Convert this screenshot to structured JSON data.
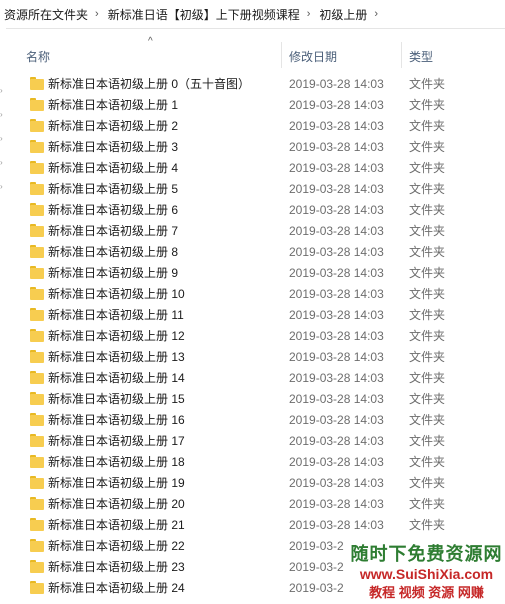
{
  "breadcrumb": {
    "items": [
      "资源所在文件夹",
      "新标准日语【初级】上下册视频课程",
      "初级上册"
    ],
    "separator": "›",
    "trailing_chevron": "›"
  },
  "columns": {
    "name": "名称",
    "date": "修改日期",
    "type": "类型"
  },
  "rows": [
    {
      "name": "新标准日本语初级上册 0（五十音图）",
      "date": "2019-03-28 14:03",
      "type": "文件夹"
    },
    {
      "name": "新标准日本语初级上册 1",
      "date": "2019-03-28 14:03",
      "type": "文件夹"
    },
    {
      "name": "新标准日本语初级上册 2",
      "date": "2019-03-28 14:03",
      "type": "文件夹"
    },
    {
      "name": "新标准日本语初级上册 3",
      "date": "2019-03-28 14:03",
      "type": "文件夹"
    },
    {
      "name": "新标准日本语初级上册 4",
      "date": "2019-03-28 14:03",
      "type": "文件夹"
    },
    {
      "name": "新标准日本语初级上册 5",
      "date": "2019-03-28 14:03",
      "type": "文件夹"
    },
    {
      "name": "新标准日本语初级上册 6",
      "date": "2019-03-28 14:03",
      "type": "文件夹"
    },
    {
      "name": "新标准日本语初级上册 7",
      "date": "2019-03-28 14:03",
      "type": "文件夹"
    },
    {
      "name": "新标准日本语初级上册 8",
      "date": "2019-03-28 14:03",
      "type": "文件夹"
    },
    {
      "name": "新标准日本语初级上册 9",
      "date": "2019-03-28 14:03",
      "type": "文件夹"
    },
    {
      "name": "新标准日本语初级上册 10",
      "date": "2019-03-28 14:03",
      "type": "文件夹"
    },
    {
      "name": "新标准日本语初级上册 11",
      "date": "2019-03-28 14:03",
      "type": "文件夹"
    },
    {
      "name": "新标准日本语初级上册 12",
      "date": "2019-03-28 14:03",
      "type": "文件夹"
    },
    {
      "name": "新标准日本语初级上册 13",
      "date": "2019-03-28 14:03",
      "type": "文件夹"
    },
    {
      "name": "新标准日本语初级上册 14",
      "date": "2019-03-28 14:03",
      "type": "文件夹"
    },
    {
      "name": "新标准日本语初级上册 15",
      "date": "2019-03-28 14:03",
      "type": "文件夹"
    },
    {
      "name": "新标准日本语初级上册 16",
      "date": "2019-03-28 14:03",
      "type": "文件夹"
    },
    {
      "name": "新标准日本语初级上册 17",
      "date": "2019-03-28 14:03",
      "type": "文件夹"
    },
    {
      "name": "新标准日本语初级上册 18",
      "date": "2019-03-28 14:03",
      "type": "文件夹"
    },
    {
      "name": "新标准日本语初级上册 19",
      "date": "2019-03-28 14:03",
      "type": "文件夹"
    },
    {
      "name": "新标准日本语初级上册 20",
      "date": "2019-03-28 14:03",
      "type": "文件夹"
    },
    {
      "name": "新标准日本语初级上册 21",
      "date": "2019-03-28 14:03",
      "type": "文件夹"
    },
    {
      "name": "新标准日本语初级上册 22",
      "date": "2019-03-2",
      "type": ""
    },
    {
      "name": "新标准日本语初级上册 23",
      "date": "2019-03-2",
      "type": ""
    },
    {
      "name": "新标准日本语初级上册 24",
      "date": "2019-03-2",
      "type": ""
    }
  ],
  "watermark": {
    "line1": "随时下免费资源网",
    "line2": "www.SuiShiXia.com",
    "line3": "教程 视频 资源 网赚"
  },
  "icons": {
    "folder": "folder-icon",
    "sort": "sort-up-icon"
  },
  "colors": {
    "folder": "#f7cd50",
    "folder_tab": "#e8b923",
    "header_text": "#4c607a",
    "meta_text": "#6d6d6d"
  }
}
